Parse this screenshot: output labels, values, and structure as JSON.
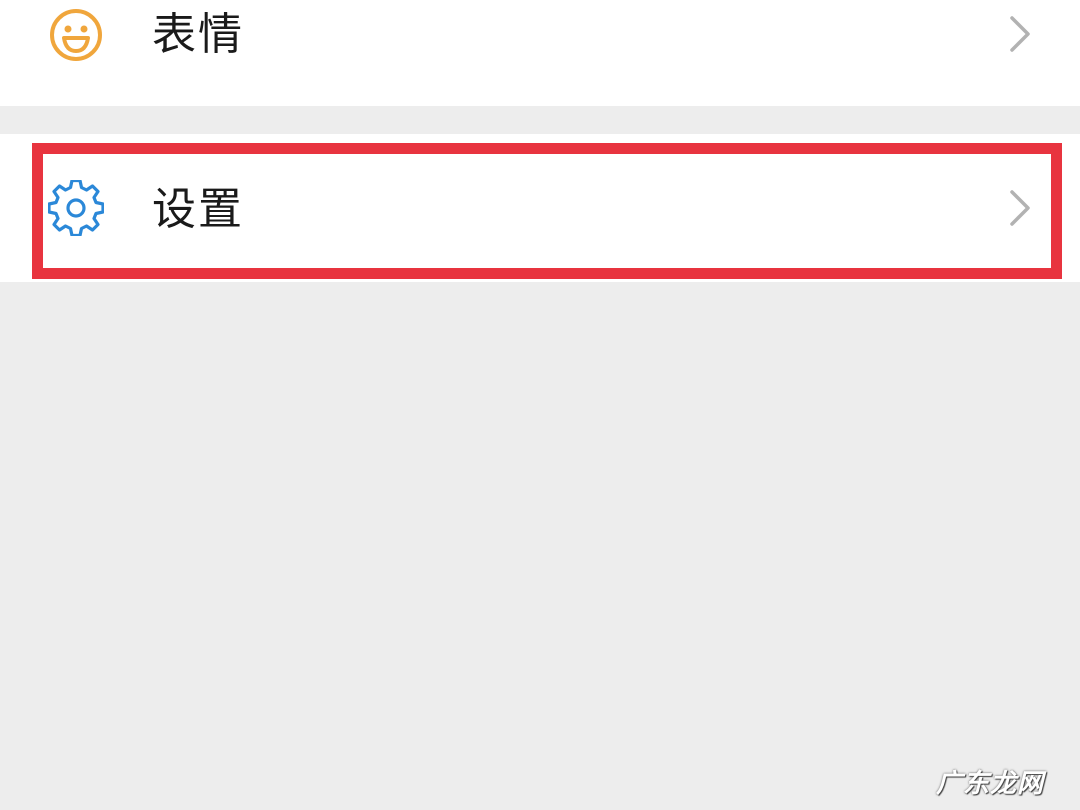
{
  "menu": {
    "items": [
      {
        "label": "表情",
        "icon": "smiley-icon",
        "icon_color": "#f0a63c"
      },
      {
        "label": "设置",
        "icon": "gear-icon",
        "icon_color": "#2b88d8"
      }
    ]
  },
  "highlight": {
    "target": "设置",
    "color": "#e8343f"
  },
  "watermark": {
    "text": "广东龙网"
  },
  "colors": {
    "background": "#ededed",
    "row_background": "#ffffff",
    "chevron": "#b2b2b2",
    "text": "#1a1a1a"
  }
}
